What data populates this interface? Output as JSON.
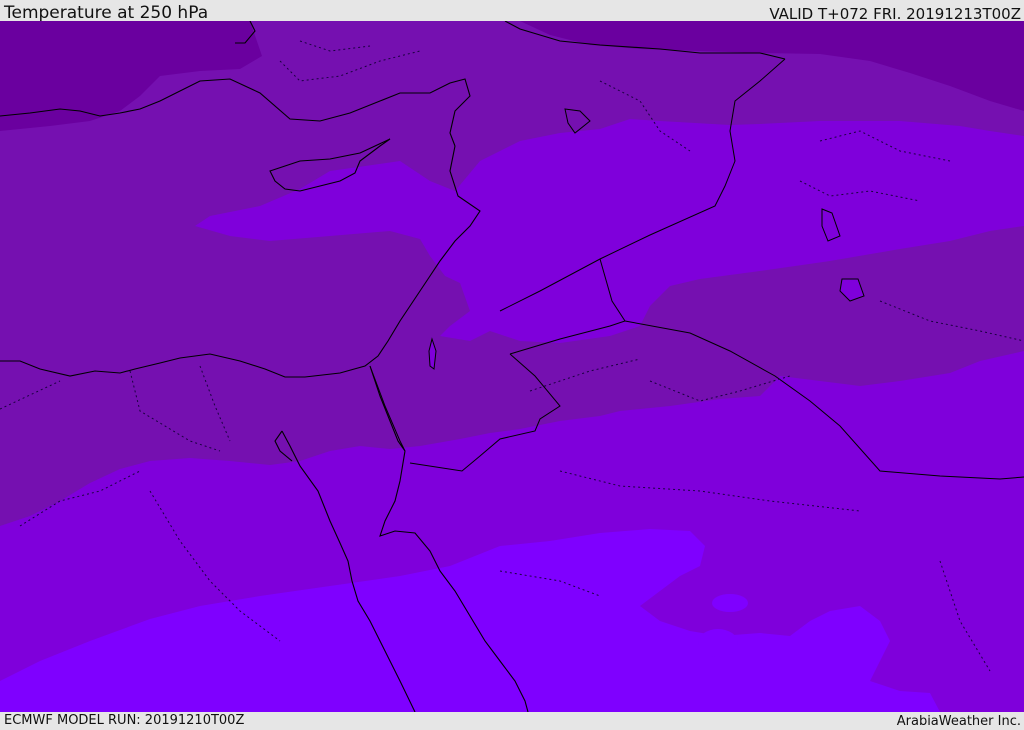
{
  "header": {
    "title": "Temperature at 250 hPa",
    "valid": "VALID T+072 FRI. 20191213T00Z"
  },
  "footer": {
    "model_run": "ECMWF MODEL RUN: 20191210T00Z",
    "credit": "ArabiaWeather Inc."
  },
  "colors": {
    "band_coldest": "#6a009f",
    "band_cold": "#7510b0",
    "band_mid": "#7f00db",
    "band_warm": "#7f00ff"
  }
}
